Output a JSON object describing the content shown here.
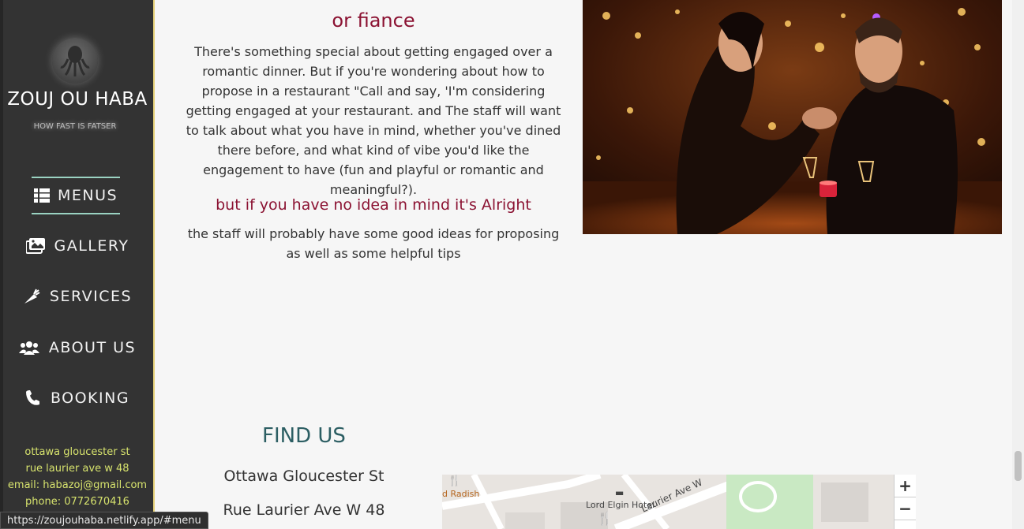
{
  "sidebar": {
    "brand": "ZOUJ OU HABA",
    "tagline": "HOW FAST IS FATSER",
    "nav": [
      {
        "label": "MENUS",
        "icon": "th-list-icon"
      },
      {
        "label": "GALLERY",
        "icon": "images-icon"
      },
      {
        "label": "SERVICES",
        "icon": "carrot-icon"
      },
      {
        "label": "ABOUT US",
        "icon": "users-icon"
      },
      {
        "label": "BOOKING",
        "icon": "phone-icon"
      }
    ],
    "contact": {
      "line1": "ottawa gloucester st",
      "line2": "rue laurier ave w 48",
      "line3": "email: habazoj@gmail.com",
      "line4": "phone: 0772670416"
    }
  },
  "main": {
    "heading_fiance": "or fiance",
    "paragraph1": "There's something special about getting engaged over a romantic dinner. But if you're wondering about how to propose in a restaurant \"Call and say, 'I'm considering getting engaged at your restaurant. and The staff will want to talk about what you have in mind, whether you've dined there before, and what kind of vibe you'd like the engagement to have (fun and playful or romantic and meaningful?).",
    "heading_idea": "but if you have no idea in mind it's Alright",
    "paragraph2": "the staff will probably have some good ideas for proposing as well as some helpful tips"
  },
  "find_us": {
    "title": "FIND US",
    "address1": "Ottawa Gloucester St",
    "address2": "Rue Laurier Ave W 48"
  },
  "map": {
    "labels": {
      "restaurant": "d Radish",
      "hotel": "Lord Elgin Hotel",
      "street": "Laurier Ave W"
    },
    "zoom_in": "+",
    "zoom_out": "−"
  },
  "status_url": "https://zoujouhaba.netlify.app/#menu",
  "colors": {
    "sidebar_bg": "#333333",
    "accent_red": "#8b1232",
    "teal": "#2c5e63",
    "contact_yellow": "#d7e36d"
  }
}
